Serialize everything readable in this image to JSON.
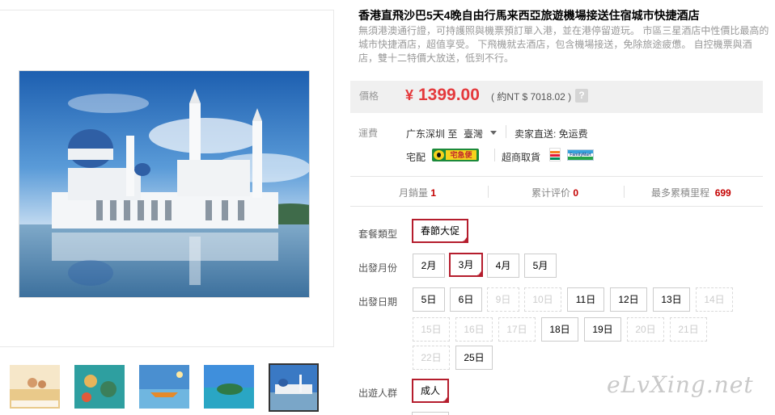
{
  "product": {
    "title": "香港直飛沙巴5天4晚自由行馬来西亞旅遊機場接送住宿城市快捷酒店",
    "subtitle": "無須港澳通行證，可持護照與機票預訂單入港，並在港停留遊玩。 市區三星酒店中性價比最高的城市快捷酒店，超值享受。 下飛機就去酒店，包含機場接送，免除旅途疲憊。 自控機票與酒店，雙十二特價大放送，低到不行。"
  },
  "price": {
    "label": "價格",
    "currency": "¥",
    "value": "1399.00",
    "converted": "( 約NT $ 7018.02 )",
    "help": "?"
  },
  "shipping": {
    "label": "運費",
    "from": "广东深圳 至",
    "dest": "臺灣",
    "seller": "卖家直送: 免运费",
    "delivery_home": "宅配",
    "blackcat_text": "宅急便",
    "delivery_store": "超商取貨",
    "famima_text": "FamilyMart"
  },
  "stats": {
    "monthly_sales_label": "月銷量",
    "monthly_sales": "1",
    "reviews_label": "累计评价",
    "reviews": "0",
    "mileage_label": "最多累積里程",
    "mileage": "699"
  },
  "options": {
    "package_label": "套餐類型",
    "package": "春節大促",
    "month_label": "出發月份",
    "months": [
      "2月",
      "3月",
      "4月",
      "5月"
    ],
    "date_label": "出發日期",
    "dates": [
      "5日",
      "6日",
      "9日",
      "10日",
      "11日",
      "12日",
      "13日",
      "14日",
      "15日",
      "16日",
      "17日",
      "18日",
      "19日",
      "20日",
      "21日",
      "22日",
      "25日"
    ],
    "people_label": "出遊人群",
    "people": "成人"
  },
  "watermark": "eLvXing.net",
  "colors": {
    "accent": "#b51d2d",
    "price": "#e4393c"
  }
}
